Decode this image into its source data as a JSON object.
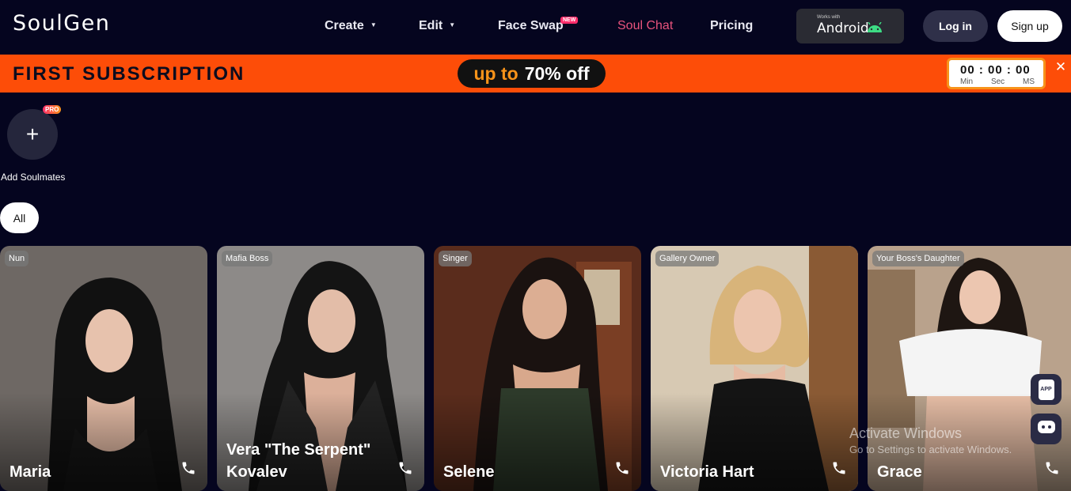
{
  "header": {
    "logo": "SoulGen",
    "nav": [
      {
        "label": "Create",
        "has_caret": true
      },
      {
        "label": "Edit",
        "has_caret": true
      },
      {
        "label": "Face Swap",
        "badge": "NEW"
      },
      {
        "label": "Soul Chat",
        "active": true
      },
      {
        "label": "Pricing"
      }
    ],
    "android": {
      "works_with": "Works with",
      "label": "Android",
      "icon": "android-icon"
    },
    "login": "Log in",
    "signup": "Sign up"
  },
  "promo": {
    "title": "FIRST SUBSCRIPTION",
    "offer_prefix": "up to",
    "offer_value": "70% off",
    "timer": {
      "digits": "00 : 00 : 00",
      "units": [
        "Min",
        "Sec",
        "MS"
      ]
    },
    "close": "✕"
  },
  "soulmates": {
    "add_icon": "+",
    "pro_badge": "PRO",
    "add_label": "Add Soulmates"
  },
  "filters": {
    "all": "All"
  },
  "cards": [
    {
      "tag": "Nun",
      "name": "Maria"
    },
    {
      "tag": "Mafia Boss",
      "name": "Vera \"The Serpent\" Kovalev"
    },
    {
      "tag": "Singer",
      "name": "Selene"
    },
    {
      "tag": "Gallery Owner",
      "name": "Victoria Hart"
    },
    {
      "tag": "Your Boss's Daughter",
      "name": "Grace"
    }
  ],
  "side_buttons": {
    "app_icon": "app-icon",
    "app_label": "APP",
    "chat_icon": "chat-bot-icon"
  },
  "watermark": {
    "line1": "Activate Windows",
    "line2": "Go to Settings to activate Windows."
  },
  "colors": {
    "background": "#05051f",
    "promo": "#fd4d08",
    "accent": "#f7931a",
    "soul_chat": "#e9537d"
  }
}
